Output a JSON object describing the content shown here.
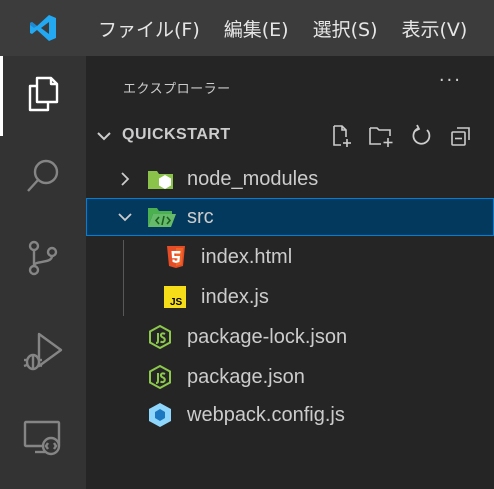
{
  "menu": {
    "items": [
      "ファイル(F)",
      "編集(E)",
      "選択(S)",
      "表示(V)"
    ]
  },
  "activity_bar": {
    "items": [
      "explorer-icon",
      "search-icon",
      "source-control-icon",
      "run-debug-icon",
      "remote-explorer-icon"
    ]
  },
  "sidebar": {
    "title": "エクスプローラー",
    "more": "···",
    "section_title": "QUICKSTART"
  },
  "tree": {
    "node_modules": "node_modules",
    "src": "src",
    "index_html": "index.html",
    "index_js": "index.js",
    "package_lock": "package-lock.json",
    "package_json": "package.json",
    "webpack_config": "webpack.config.js"
  },
  "colors": {
    "accent": "#007fd4",
    "selection": "#04395e",
    "vscode_blue": "#23a9f2",
    "folder_green": "#8bc34a",
    "html_orange": "#e44d26",
    "js_yellow": "#f5de19",
    "node_green": "#8cc84b",
    "webpack_blue": "#8ed6fb"
  }
}
